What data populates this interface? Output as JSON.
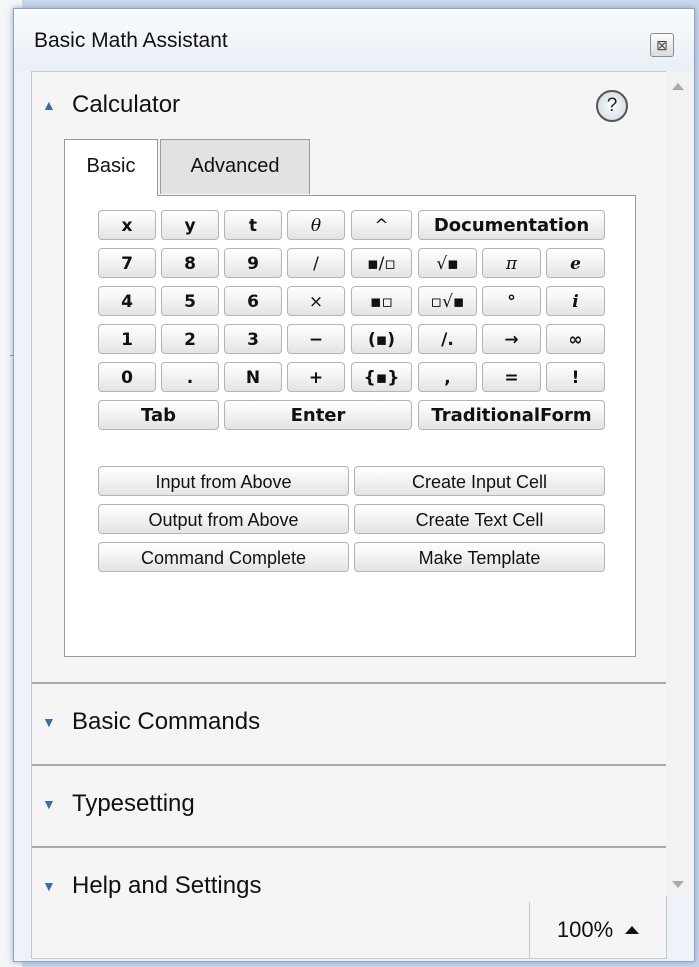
{
  "window": {
    "title": "Basic Math Assistant",
    "close_label": "⊠"
  },
  "calculator": {
    "header": "Calculator",
    "help_label": "?",
    "tabs": [
      "Basic",
      "Advanced"
    ],
    "keypad_rows": [
      [
        "x",
        "y",
        "t",
        "θ",
        "^",
        "Documentation"
      ],
      [
        "7",
        "8",
        "9",
        "/",
        "▪/▫",
        "√▪",
        "π",
        "e"
      ],
      [
        "4",
        "5",
        "6",
        "×",
        "▪▫",
        "▫√▪",
        "°",
        "i"
      ],
      [
        "1",
        "2",
        "3",
        "−",
        "(▪)",
        "/.",
        "→",
        "∞"
      ],
      [
        "0",
        ".",
        "N",
        "+",
        "{▪}",
        ",",
        "=",
        "!"
      ],
      [
        "Tab",
        "Enter",
        "TraditionalForm"
      ]
    ],
    "cell_buttons": [
      [
        "Input from Above",
        "Create Input Cell"
      ],
      [
        "Output from Above",
        "Create Text Cell"
      ],
      [
        "Command Complete",
        "Make Template"
      ]
    ]
  },
  "sections": [
    {
      "label": "Basic Commands"
    },
    {
      "label": "Typesetting"
    },
    {
      "label": "Help and Settings"
    }
  ],
  "zoom": {
    "level": "100%"
  }
}
